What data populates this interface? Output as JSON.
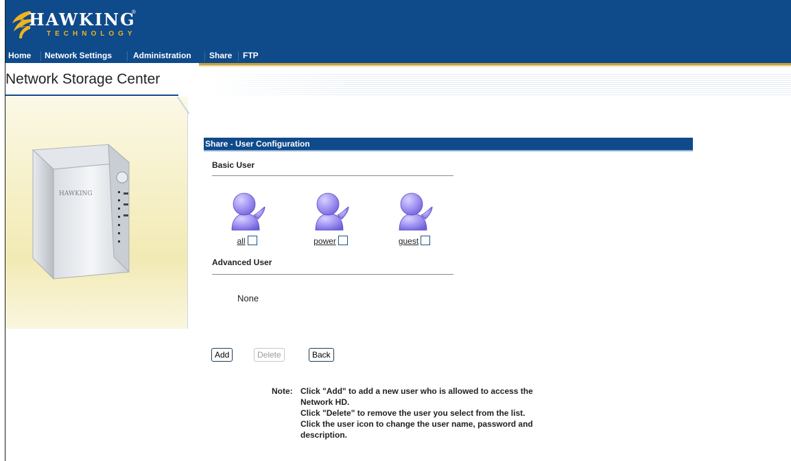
{
  "brand": {
    "name": "HAWKING",
    "sub": "TECHNOLOGY",
    "reg": "®"
  },
  "nav": {
    "items": [
      "Home",
      "Network Settings",
      "Administration",
      "Share",
      "FTP"
    ]
  },
  "site_title": "Network Storage Center",
  "section": {
    "title": "Share - User Configuration",
    "basic_user_heading": "Basic User",
    "users": [
      "all",
      "power",
      "guest"
    ],
    "advanced_user_heading": "Advanced User",
    "advanced_users_text": "None"
  },
  "buttons": {
    "add": "Add",
    "delete": "Delete",
    "back": "Back"
  },
  "note": {
    "prefix": "Note:",
    "lines": [
      "Click \"Add\" to add a new user who is allowed to access the",
      "Network HD.",
      "Click \"Delete\" to remove the user you select from the list.",
      "Click the user icon to change the user name, password and",
      "description."
    ]
  },
  "colors": {
    "header": "#0f4a8a",
    "accent_gold": "#c7a03c",
    "user_icon": "#9a8cf0"
  }
}
